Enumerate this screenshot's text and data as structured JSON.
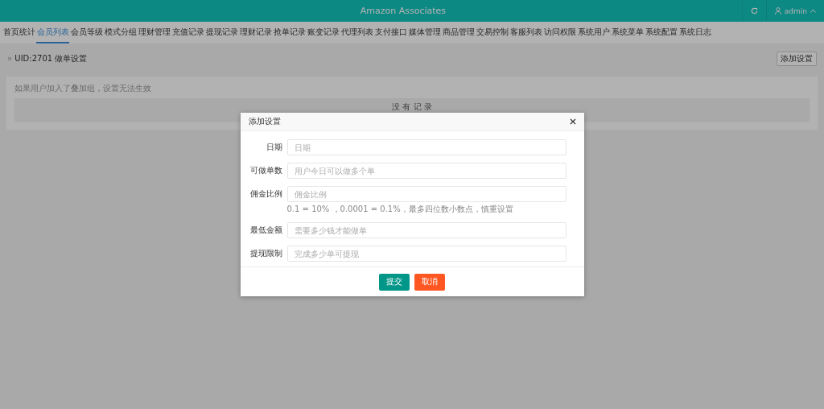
{
  "header": {
    "title": "Amazon Associates",
    "user": "admin"
  },
  "nav": [
    {
      "label": "首页统计",
      "selected": false
    },
    {
      "label": "会员列表",
      "selected": true
    },
    {
      "label": "会员等级",
      "selected": false
    },
    {
      "label": "模式分组",
      "selected": false
    },
    {
      "label": "理财管理",
      "selected": false
    },
    {
      "label": "充值记录",
      "selected": false
    },
    {
      "label": "提现记录",
      "selected": false
    },
    {
      "label": "理财记录",
      "selected": false
    },
    {
      "label": "抢单记录",
      "selected": false
    },
    {
      "label": "账变记录",
      "selected": false
    },
    {
      "label": "代理列表",
      "selected": false
    },
    {
      "label": "支付接口",
      "selected": false
    },
    {
      "label": "媒体管理",
      "selected": false
    },
    {
      "label": "商品管理",
      "selected": false
    },
    {
      "label": "交易控制",
      "selected": false
    },
    {
      "label": "客服列表",
      "selected": false
    },
    {
      "label": "访问权限",
      "selected": false
    },
    {
      "label": "系统用户",
      "selected": false
    },
    {
      "label": "系统菜单",
      "selected": false
    },
    {
      "label": "系统配置",
      "selected": false
    },
    {
      "label": "系统日志",
      "selected": false
    }
  ],
  "breadcrumb": {
    "marker": "»",
    "text": "UID:2701 做单设置"
  },
  "add_button": "添加设置",
  "panel": {
    "note": "如果用户加入了叠加组，设置无法生效",
    "empty_text": "没 有 记 录"
  },
  "dialog": {
    "title": "添加设置",
    "fields": [
      {
        "label": "日期",
        "placeholder": "日期"
      },
      {
        "label": "可做单数",
        "placeholder": "用户今日可以做多个单"
      },
      {
        "label": "佣金比例",
        "placeholder": "佣金比例",
        "help": "0.1 = 10% ，0.0001 = 0.1%，最多四位数小数点，慎重设置"
      },
      {
        "label": "最低金额",
        "placeholder": "需要多少钱才能做单"
      },
      {
        "label": "提现限制",
        "placeholder": "完成多少单可提现"
      }
    ],
    "buttons": [
      {
        "label": "提交",
        "kind": "primary"
      },
      {
        "label": "取消",
        "kind": "danger"
      }
    ]
  }
}
